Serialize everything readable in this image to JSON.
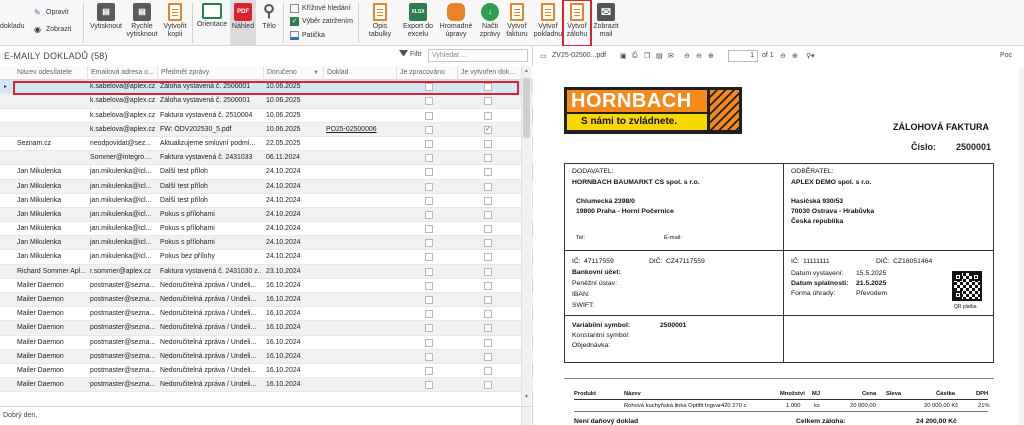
{
  "ribbon": {
    "btn_doklady": "dokladu",
    "btn_opravit": "Opravit",
    "btn_zobrazit": "Zobrazit",
    "btn_vytisknout": "Vytisknout",
    "btn_rychle": "Rychle vytisknout",
    "btn_vytvorit_kopii": "Vytvořit kopii",
    "btn_orientace": "Orientace",
    "btn_nahled": "Náhled",
    "btn_telo": "Tělo",
    "opt_krizove": "Křížové hledání",
    "opt_vyber": "Výběr zatržením",
    "opt_paticka": "Patička",
    "btn_opis": "Opis tabulky",
    "btn_export": "Export do excelu",
    "btn_hromadne": "Hromadné úpravy",
    "btn_nacti": "Načti zprávy",
    "btn_vytvor_fakturu": "Vytvoř fakturu",
    "btn_vytvor_pokladnu": "Vytvoř pokladnu",
    "btn_vytvor_zalohu": "Vytvoř zálohu",
    "btn_zobrazit_mail": "Zobrazit mail"
  },
  "list": {
    "title": "E-MAILY DOKLADŮ (58)",
    "filter_label": "Filtr",
    "search_placeholder": "Vyhledat ...",
    "columns": [
      "Název odesílatele",
      "Emailová adresa o...",
      "Předmět zprávy",
      "Doručeno",
      "Doklad",
      "Je zpracováno",
      "Je vytvořen dok..."
    ],
    "rows": [
      {
        "name": "",
        "email": "k.sabelova@aplex.cz",
        "subject": "Záloha vystavená č. 2500001",
        "date": "10.06.2025",
        "doc": "",
        "processed": false,
        "created": false
      },
      {
        "name": "",
        "email": "k.sabelova@aplex.cz",
        "subject": "Záloha vystavená č. 2500001",
        "date": "10.06.2025",
        "doc": "",
        "processed": false,
        "created": false
      },
      {
        "name": "",
        "email": "k.sabelova@aplex.cz",
        "subject": "Faktura vystavená č. 2510004",
        "date": "10.06.2025",
        "doc": "",
        "processed": false,
        "created": false
      },
      {
        "name": "",
        "email": "k.sabelova@aplex.cz",
        "subject": "FW: ODV202530_5.pdf",
        "date": "10.06.2025",
        "doc": "PO25-02500006",
        "processed": false,
        "created": true
      },
      {
        "name": "Seznam.cz",
        "email": "neodpovidat@sez...",
        "subject": "Aktualizujeme smluvní podmí...",
        "date": "22.05.2025",
        "doc": "",
        "processed": false,
        "created": false
      },
      {
        "name": "",
        "email": "Sommer@integro....",
        "subject": "Faktura vystavená č. 2431033",
        "date": "06.11.2024",
        "doc": "",
        "processed": false,
        "created": false
      },
      {
        "name": "Jan Mikulenka",
        "email": "jan.mikulenka@icl...",
        "subject": "Další test příloh",
        "date": "24.10.2024",
        "doc": "",
        "processed": false,
        "created": false
      },
      {
        "name": "Jan Mikulenka",
        "email": "jan.mikulenka@icl...",
        "subject": "Další test příloh",
        "date": "24.10.2024",
        "doc": "",
        "processed": false,
        "created": false
      },
      {
        "name": "Jan Mikulenka",
        "email": "jan.mikulenka@icl...",
        "subject": "Další test příloh",
        "date": "24.10.2024",
        "doc": "",
        "processed": false,
        "created": false
      },
      {
        "name": "Jan Mikulenka",
        "email": "jan.mikulenka@icl...",
        "subject": "Pokus s přílohami",
        "date": "24.10.2024",
        "doc": "",
        "processed": false,
        "created": false
      },
      {
        "name": "Jan Mikulenka",
        "email": "jan.mikulenka@icl...",
        "subject": "Pokus s přílohami",
        "date": "24.10.2024",
        "doc": "",
        "processed": false,
        "created": false
      },
      {
        "name": "Jan Mikulenka",
        "email": "jan.mikulenka@icl...",
        "subject": "Pokus s přílohami",
        "date": "24.10.2024",
        "doc": "",
        "processed": false,
        "created": false
      },
      {
        "name": "Jan Mikulenka",
        "email": "jan.mikulenka@icl...",
        "subject": "Pokus bez přílohy",
        "date": "24.10.2024",
        "doc": "",
        "processed": false,
        "created": false
      },
      {
        "name": "Richard Sommer Apl...",
        "email": "r.sommer@aplex.cz",
        "subject": "Faktura vystavená č. 2431030 z...",
        "date": "23.10.2024",
        "doc": "",
        "processed": false,
        "created": false
      },
      {
        "name": "Mailer Daemon",
        "email": "postmaster@sezna...",
        "subject": "Nedoručitelná zpráva / Undeli...",
        "date": "16.10.2024",
        "doc": "",
        "processed": false,
        "created": false
      },
      {
        "name": "Mailer Daemon",
        "email": "postmaster@sezna...",
        "subject": "Nedoručitelná zpráva / Undeli...",
        "date": "16.10.2024",
        "doc": "",
        "processed": false,
        "created": false
      },
      {
        "name": "Mailer Daemon",
        "email": "postmaster@sezna...",
        "subject": "Nedoručitelná zpráva / Undeli...",
        "date": "16.10.2024",
        "doc": "",
        "processed": false,
        "created": false
      },
      {
        "name": "Mailer Daemon",
        "email": "postmaster@sezna...",
        "subject": "Nedoručitelná zpráva / Undeli...",
        "date": "16.10.2024",
        "doc": "",
        "processed": false,
        "created": false
      },
      {
        "name": "Mailer Daemon",
        "email": "postmaster@sezna...",
        "subject": "Nedoručitelná zpráva / Undeli...",
        "date": "16.10.2024",
        "doc": "",
        "processed": false,
        "created": false
      },
      {
        "name": "Mailer Daemon",
        "email": "postmaster@sezna...",
        "subject": "Nedoručitelná zpráva / Undeli...",
        "date": "16.10.2024",
        "doc": "",
        "processed": false,
        "created": false
      },
      {
        "name": "Mailer Daemon",
        "email": "postmaster@sezna...",
        "subject": "Nedoručitelná zpráva / Undeli...",
        "date": "16.10.2024",
        "doc": "",
        "processed": false,
        "created": false
      },
      {
        "name": "Mailer Daemon",
        "email": "postmaster@sezna...",
        "subject": "Nedoručitelná zpráva / Undeli...",
        "date": "16.10.2024",
        "doc": "",
        "processed": false,
        "created": false
      }
    ],
    "preview_text": "Dobrý den,"
  },
  "pdf": {
    "file_name": "ZV25-02500...pdf",
    "page_current": "1",
    "page_total": "of 1",
    "right_label": "Poc",
    "logo_text": "HORNBACH",
    "logo_slogan": "S námi to zvládnete.",
    "doc_title": "ZÁLOHOVÁ FAKTURA",
    "number_label": "Číslo:",
    "number_value": "2500001",
    "supplier": {
      "label": "DODAVATEL:",
      "name": "HORNBACH BAUMARKT CS spol. s r.o.",
      "street": "Chlumecká 2398/0",
      "city": "19800   Praha - Horní Počernice",
      "tel": "Tel:",
      "email": "E-mail:",
      "ic_label": "IČ:",
      "ic": "47117559",
      "dic_label": "DIČ:",
      "dic": "CZ47117559",
      "bank_label": "Bankovní účet:",
      "bank_inst": "Peněžní ústav:",
      "iban": "IBAN:",
      "swift": "SWIFT:",
      "vs_label": "Variabilní symbol:",
      "vs": "2500001",
      "ks_label": "Konstantní symbol:",
      "order_label": "Objednávka:"
    },
    "customer": {
      "label": "ODBĚRATEL:",
      "name": "APLEX DEMO spol. s r.o.",
      "street": "Hasičská 930/53",
      "city": "70030   Ostrava - Hrabůvka",
      "country": "Česká republika",
      "ic_label": "IČ:",
      "ic": "11111111",
      "dic_label": "DIČ:",
      "dic": "CZ18051464",
      "issue_label": "Datum vystavení:",
      "issue": "15.5.2025",
      "due_label": "Datum splatnosti:",
      "due": "21.5.2025",
      "pay_label": "Forma úhrady:",
      "pay": "Převodem",
      "qr_label": "QR platba"
    },
    "items_header": [
      "Produkt",
      "Název",
      "Množství",
      "MJ",
      "Cena",
      "Sleva",
      "Částka",
      "DPH"
    ],
    "items": [
      {
        "product": "",
        "name": "Rohová kuchyňská linka Optifit Ingvar420 270 c",
        "qty": "1.000",
        "unit": "ks",
        "price": "20 000,00",
        "discount": "",
        "amount": "20 000,00 Kč",
        "vat": "21%"
      }
    ],
    "non_tax": "Není daňový doklad",
    "total_label": "Celkem záloha:",
    "total_value": "24 200,00 Kč"
  },
  "colors": {
    "accent_orange": "#e8832a",
    "selection_blue": "#d4e7f7",
    "highlight_red": "#d9232e",
    "hornbach_orange": "#f38a1a",
    "hornbach_yellow": "#f8d700"
  }
}
